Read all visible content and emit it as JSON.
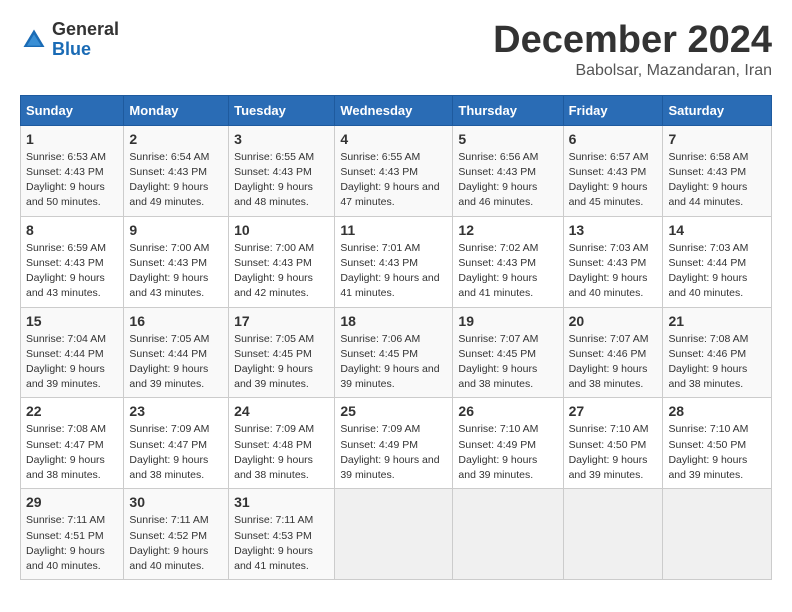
{
  "header": {
    "logo_general": "General",
    "logo_blue": "Blue",
    "month_title": "December 2024",
    "location": "Babolsar, Mazandaran, Iran"
  },
  "weekdays": [
    "Sunday",
    "Monday",
    "Tuesday",
    "Wednesday",
    "Thursday",
    "Friday",
    "Saturday"
  ],
  "weeks": [
    [
      {
        "day": "1",
        "sunrise": "Sunrise: 6:53 AM",
        "sunset": "Sunset: 4:43 PM",
        "daylight": "Daylight: 9 hours and 50 minutes."
      },
      {
        "day": "2",
        "sunrise": "Sunrise: 6:54 AM",
        "sunset": "Sunset: 4:43 PM",
        "daylight": "Daylight: 9 hours and 49 minutes."
      },
      {
        "day": "3",
        "sunrise": "Sunrise: 6:55 AM",
        "sunset": "Sunset: 4:43 PM",
        "daylight": "Daylight: 9 hours and 48 minutes."
      },
      {
        "day": "4",
        "sunrise": "Sunrise: 6:55 AM",
        "sunset": "Sunset: 4:43 PM",
        "daylight": "Daylight: 9 hours and 47 minutes."
      },
      {
        "day": "5",
        "sunrise": "Sunrise: 6:56 AM",
        "sunset": "Sunset: 4:43 PM",
        "daylight": "Daylight: 9 hours and 46 minutes."
      },
      {
        "day": "6",
        "sunrise": "Sunrise: 6:57 AM",
        "sunset": "Sunset: 4:43 PM",
        "daylight": "Daylight: 9 hours and 45 minutes."
      },
      {
        "day": "7",
        "sunrise": "Sunrise: 6:58 AM",
        "sunset": "Sunset: 4:43 PM",
        "daylight": "Daylight: 9 hours and 44 minutes."
      }
    ],
    [
      {
        "day": "8",
        "sunrise": "Sunrise: 6:59 AM",
        "sunset": "Sunset: 4:43 PM",
        "daylight": "Daylight: 9 hours and 43 minutes."
      },
      {
        "day": "9",
        "sunrise": "Sunrise: 7:00 AM",
        "sunset": "Sunset: 4:43 PM",
        "daylight": "Daylight: 9 hours and 43 minutes."
      },
      {
        "day": "10",
        "sunrise": "Sunrise: 7:00 AM",
        "sunset": "Sunset: 4:43 PM",
        "daylight": "Daylight: 9 hours and 42 minutes."
      },
      {
        "day": "11",
        "sunrise": "Sunrise: 7:01 AM",
        "sunset": "Sunset: 4:43 PM",
        "daylight": "Daylight: 9 hours and 41 minutes."
      },
      {
        "day": "12",
        "sunrise": "Sunrise: 7:02 AM",
        "sunset": "Sunset: 4:43 PM",
        "daylight": "Daylight: 9 hours and 41 minutes."
      },
      {
        "day": "13",
        "sunrise": "Sunrise: 7:03 AM",
        "sunset": "Sunset: 4:43 PM",
        "daylight": "Daylight: 9 hours and 40 minutes."
      },
      {
        "day": "14",
        "sunrise": "Sunrise: 7:03 AM",
        "sunset": "Sunset: 4:44 PM",
        "daylight": "Daylight: 9 hours and 40 minutes."
      }
    ],
    [
      {
        "day": "15",
        "sunrise": "Sunrise: 7:04 AM",
        "sunset": "Sunset: 4:44 PM",
        "daylight": "Daylight: 9 hours and 39 minutes."
      },
      {
        "day": "16",
        "sunrise": "Sunrise: 7:05 AM",
        "sunset": "Sunset: 4:44 PM",
        "daylight": "Daylight: 9 hours and 39 minutes."
      },
      {
        "day": "17",
        "sunrise": "Sunrise: 7:05 AM",
        "sunset": "Sunset: 4:45 PM",
        "daylight": "Daylight: 9 hours and 39 minutes."
      },
      {
        "day": "18",
        "sunrise": "Sunrise: 7:06 AM",
        "sunset": "Sunset: 4:45 PM",
        "daylight": "Daylight: 9 hours and 39 minutes."
      },
      {
        "day": "19",
        "sunrise": "Sunrise: 7:07 AM",
        "sunset": "Sunset: 4:45 PM",
        "daylight": "Daylight: 9 hours and 38 minutes."
      },
      {
        "day": "20",
        "sunrise": "Sunrise: 7:07 AM",
        "sunset": "Sunset: 4:46 PM",
        "daylight": "Daylight: 9 hours and 38 minutes."
      },
      {
        "day": "21",
        "sunrise": "Sunrise: 7:08 AM",
        "sunset": "Sunset: 4:46 PM",
        "daylight": "Daylight: 9 hours and 38 minutes."
      }
    ],
    [
      {
        "day": "22",
        "sunrise": "Sunrise: 7:08 AM",
        "sunset": "Sunset: 4:47 PM",
        "daylight": "Daylight: 9 hours and 38 minutes."
      },
      {
        "day": "23",
        "sunrise": "Sunrise: 7:09 AM",
        "sunset": "Sunset: 4:47 PM",
        "daylight": "Daylight: 9 hours and 38 minutes."
      },
      {
        "day": "24",
        "sunrise": "Sunrise: 7:09 AM",
        "sunset": "Sunset: 4:48 PM",
        "daylight": "Daylight: 9 hours and 38 minutes."
      },
      {
        "day": "25",
        "sunrise": "Sunrise: 7:09 AM",
        "sunset": "Sunset: 4:49 PM",
        "daylight": "Daylight: 9 hours and 39 minutes."
      },
      {
        "day": "26",
        "sunrise": "Sunrise: 7:10 AM",
        "sunset": "Sunset: 4:49 PM",
        "daylight": "Daylight: 9 hours and 39 minutes."
      },
      {
        "day": "27",
        "sunrise": "Sunrise: 7:10 AM",
        "sunset": "Sunset: 4:50 PM",
        "daylight": "Daylight: 9 hours and 39 minutes."
      },
      {
        "day": "28",
        "sunrise": "Sunrise: 7:10 AM",
        "sunset": "Sunset: 4:50 PM",
        "daylight": "Daylight: 9 hours and 39 minutes."
      }
    ],
    [
      {
        "day": "29",
        "sunrise": "Sunrise: 7:11 AM",
        "sunset": "Sunset: 4:51 PM",
        "daylight": "Daylight: 9 hours and 40 minutes."
      },
      {
        "day": "30",
        "sunrise": "Sunrise: 7:11 AM",
        "sunset": "Sunset: 4:52 PM",
        "daylight": "Daylight: 9 hours and 40 minutes."
      },
      {
        "day": "31",
        "sunrise": "Sunrise: 7:11 AM",
        "sunset": "Sunset: 4:53 PM",
        "daylight": "Daylight: 9 hours and 41 minutes."
      },
      null,
      null,
      null,
      null
    ]
  ]
}
